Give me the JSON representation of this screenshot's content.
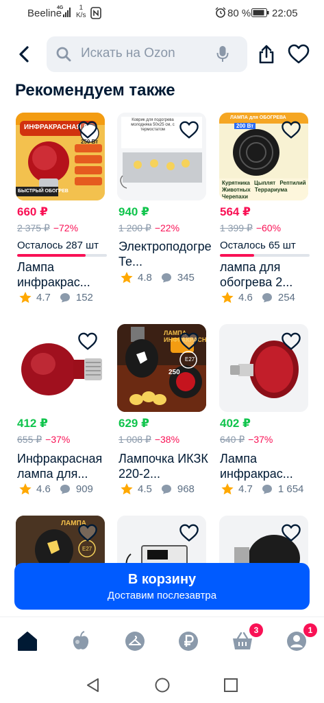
{
  "status_bar": {
    "carrier": "Beeline",
    "network": "4G",
    "speed_value": "1",
    "speed_unit": "K/s",
    "battery": "80 %",
    "time": "22:05",
    "icons": [
      "signal-icon",
      "nfc-icon",
      "alarm-icon",
      "battery-icon"
    ]
  },
  "header": {
    "back_icon": "back-arrow-icon",
    "search_placeholder": "Искать на Ozon",
    "search_icon": "search-icon",
    "mic_icon": "microphone-icon",
    "share_icon": "share-icon",
    "favorite_icon": "heart-icon"
  },
  "section_title": "Рекомендуем также",
  "products": [
    {
      "image_caption": "ИНФРАКРАСНАЯ Л",
      "image_badge": "250 Вт",
      "image_footer": "БЫСТРЫЙ ОБОГРЕВ",
      "image_tags": [
        "ДЛЯ ПТИЦ",
        "ДЛЯ ДОМАШНИХ ЖИВОТНЫХ",
        "ДЛЯ БРОЙЛЕРА",
        "ДЛЯ РАССАДЫ",
        "ДЛЯ ИНКУБАТОРА"
      ],
      "price": "660 ₽",
      "price_color": "red",
      "old_price": "2 375 ₽",
      "discount": "−72%",
      "stock_left": "Осталось 287 шт",
      "stock_fill": 0.76,
      "title": "Лампа инфракрас...",
      "rating": "4.7",
      "reviews": "152"
    },
    {
      "image_caption": "Коврик для подогрева молодняка 50х25 см, с термостатом",
      "image_notes": [
        "Защита от холода и болезней",
        "Укрепляется здоровье молодняка",
        "Молодняк становится активным",
        "Повышает рост и прирост веса",
        "Ровная поверхность, грея 5 снизу"
      ],
      "price": "940 ₽",
      "price_color": "green",
      "old_price": "1 200 ₽",
      "discount": "−22%",
      "title": "Электроподогреватель Те...",
      "rating": "4.8",
      "reviews": "345"
    },
    {
      "image_caption": "ЛАМПА для ОБОГРЕВА",
      "image_badge": "200 Вт",
      "image_tags": [
        "Курятника",
        "Цыплят",
        "Рептилий",
        "Животных",
        "Террариума",
        "Черепахи"
      ],
      "price": "564 ₽",
      "price_color": "red",
      "old_price": "1 399 ₽",
      "discount": "−60%",
      "stock_left": "Осталось 65 шт",
      "stock_fill": 0.38,
      "title": "лампа для обогрева 2...",
      "rating": "4.6",
      "reviews": "254"
    },
    {
      "price": "412 ₽",
      "price_color": "green",
      "old_price": "655 ₽",
      "discount": "−37%",
      "title": "Инфракрасная лампа для...",
      "rating": "4.6",
      "reviews": "909"
    },
    {
      "image_caption": "ЛАМПА ИНФРАКРАСНАЯ",
      "image_badge": "250",
      "image_tag": "E27",
      "price": "629 ₽",
      "price_color": "green",
      "old_price": "1 008 ₽",
      "discount": "−38%",
      "title": "Лампочка ИКЗК 220-2...",
      "rating": "4.5",
      "reviews": "968"
    },
    {
      "price": "402 ₽",
      "price_color": "green",
      "old_price": "640 ₽",
      "discount": "−37%",
      "title": "Лампа инфракрас...",
      "rating": "4.7",
      "reviews": "1 654"
    },
    {
      "image_caption": "ЛАМПА",
      "image_tag": "E27"
    },
    {},
    {}
  ],
  "cart_button": {
    "label": "В корзину",
    "sublabel": "Доставим послезавтра",
    "color": "#005bff"
  },
  "tab_bar": {
    "items": [
      {
        "icon": "home-icon",
        "active": true
      },
      {
        "icon": "fresh-apple-icon"
      },
      {
        "icon": "hanger-icon"
      },
      {
        "icon": "ruble-icon"
      },
      {
        "icon": "basket-icon",
        "badge": "3"
      },
      {
        "icon": "profile-icon",
        "badge": "1"
      }
    ]
  },
  "system_nav": [
    "back-triangle-icon",
    "home-circle-icon",
    "recents-square-icon"
  ],
  "colors": {
    "accent": "#005bff",
    "price_green": "#10c44c",
    "price_red": "#f91155",
    "text": "#001a34",
    "muted": "#8b9aab"
  }
}
